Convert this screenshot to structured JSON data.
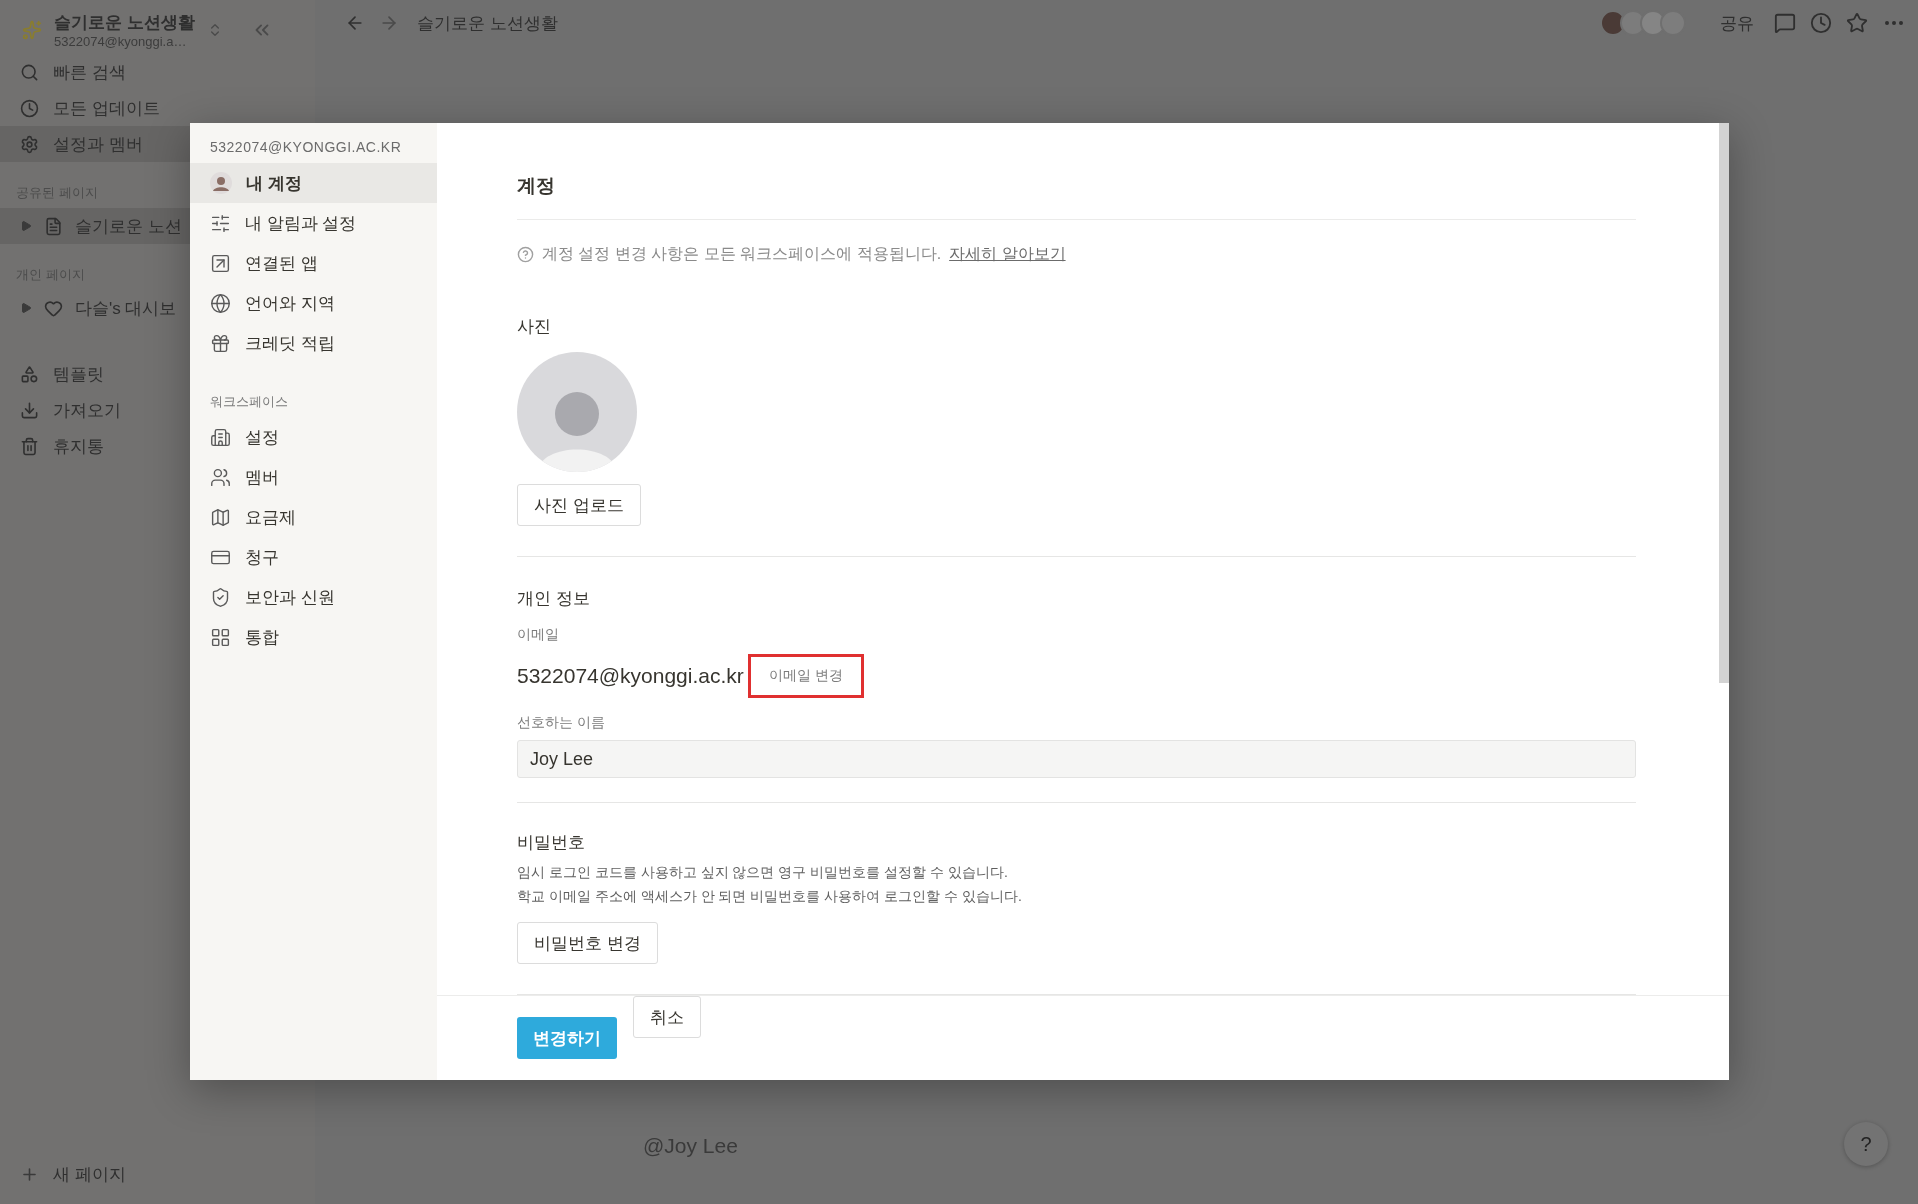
{
  "sidebar": {
    "workspace": {
      "name": "슬기로운 노션생활",
      "email": "5322074@kyonggi.a…"
    },
    "nav": [
      {
        "label": "빠른 검색",
        "kind": "search",
        "selected": false
      },
      {
        "label": "모든 업데이트",
        "kind": "clock",
        "selected": false
      },
      {
        "label": "설정과 멤버",
        "kind": "gear",
        "selected": true
      }
    ],
    "sections": [
      {
        "title": "공유된 페이지",
        "pages": [
          {
            "title": "슬기로운 노션",
            "kind": "document",
            "selected": true
          }
        ]
      },
      {
        "title": "개인 페이지",
        "pages": [
          {
            "title": "다슬's 대시보",
            "kind": "heart",
            "selected": false
          }
        ]
      }
    ],
    "tools": [
      {
        "label": "템플릿",
        "kind": "shapes"
      },
      {
        "label": "가져오기",
        "kind": "download"
      },
      {
        "label": "휴지통",
        "kind": "trash"
      }
    ],
    "new_page": "새 페이지"
  },
  "topbar": {
    "breadcrumb": "슬기로운 노션생활",
    "share": "공유"
  },
  "page": {
    "mention": "@Joy Lee",
    "help": "?"
  },
  "settings": {
    "account_email": "5322074@KYONGGI.AC.KR",
    "account_items": [
      {
        "label": "내 계정",
        "kind": "avatar",
        "selected": true
      },
      {
        "label": "내 알림과 설정",
        "kind": "sliders",
        "selected": false
      },
      {
        "label": "연결된 앱",
        "kind": "external",
        "selected": false
      },
      {
        "label": "언어와 지역",
        "kind": "globe",
        "selected": false
      },
      {
        "label": "크레딧 적립",
        "kind": "gift",
        "selected": false
      }
    ],
    "workspace_title": "워크스페이스",
    "workspace_items": [
      {
        "label": "설정",
        "kind": "building",
        "selected": false
      },
      {
        "label": "멤버",
        "kind": "people",
        "selected": false
      },
      {
        "label": "요금제",
        "kind": "map",
        "selected": false
      },
      {
        "label": "청구",
        "kind": "card",
        "selected": false
      },
      {
        "label": "보안과 신원",
        "kind": "shield",
        "selected": false
      },
      {
        "label": "통합",
        "kind": "grid",
        "selected": false
      }
    ],
    "title": "계정",
    "notice": "계정 설정 변경 사항은 모든 워크스페이스에 적용됩니다.",
    "notice_link": "자세히 알아보기",
    "photo_label": "사진",
    "upload_button": "사진 업로드",
    "personal_title": "개인 정보",
    "email_label": "이메일",
    "email": "5322074@kyonggi.ac.kr",
    "change_email": {
      "label": "이메일 변경",
      "highlighted": true
    },
    "name_label": "선호하는 이름",
    "name_value": "Joy Lee",
    "password_title": "비밀번호",
    "password_lines": [
      "임시 로그인 코드를 사용하고 싶지 않으면 영구 비밀번호를 설정할 수 있습니다.",
      "학교 이메일 주소에 액세스가 안 되면 비밀번호를 사용하여 로그인할 수 있습니다."
    ],
    "password_button": "비밀번호 변경",
    "save_button": "변경하기",
    "cancel_button": "취소"
  }
}
